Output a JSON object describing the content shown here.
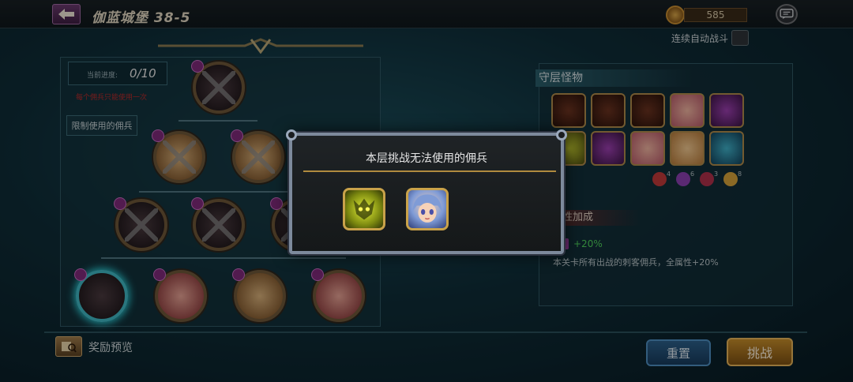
{
  "header": {
    "stage_title": "伽蓝城堡 38-5",
    "gold_amount": "585",
    "auto_battle_label": "连续自动战斗"
  },
  "left_panel": {
    "progress_label": "当前进度:",
    "progress_value": "0/10",
    "warning_text": "每个佣兵只能使用一次",
    "limit_button_label": "限制使用的佣兵",
    "reward_preview_label": "奖励预览"
  },
  "right_panel": {
    "header": "守层怪物",
    "monster_colors": [
      "m-dark",
      "m-dark",
      "m-dark",
      "m-pink",
      "m-purple",
      "m-yellow",
      "m-purple",
      "m-pink",
      "m-gold",
      "m-blue"
    ],
    "elements": [
      {
        "count": "4",
        "color": "#c03a3a"
      },
      {
        "count": "6",
        "color": "#8a3fb0"
      },
      {
        "count": "3",
        "color": "#b0304a"
      },
      {
        "count": "8",
        "color": "#d6a23a"
      }
    ],
    "attr_header": "性加成",
    "attr_value": "+20%",
    "attr_desc": "本关卡所有出战的刺客佣兵，全属性+20%"
  },
  "buttons": {
    "reset_label": "重置",
    "fight_label": "挑战"
  },
  "modal": {
    "title": "本层挑战无法使用的佣兵",
    "units": [
      {
        "name": "yellow-beast",
        "style": "unit-yellow"
      },
      {
        "name": "blue-haired-girl",
        "style": "unit-girl"
      }
    ]
  }
}
